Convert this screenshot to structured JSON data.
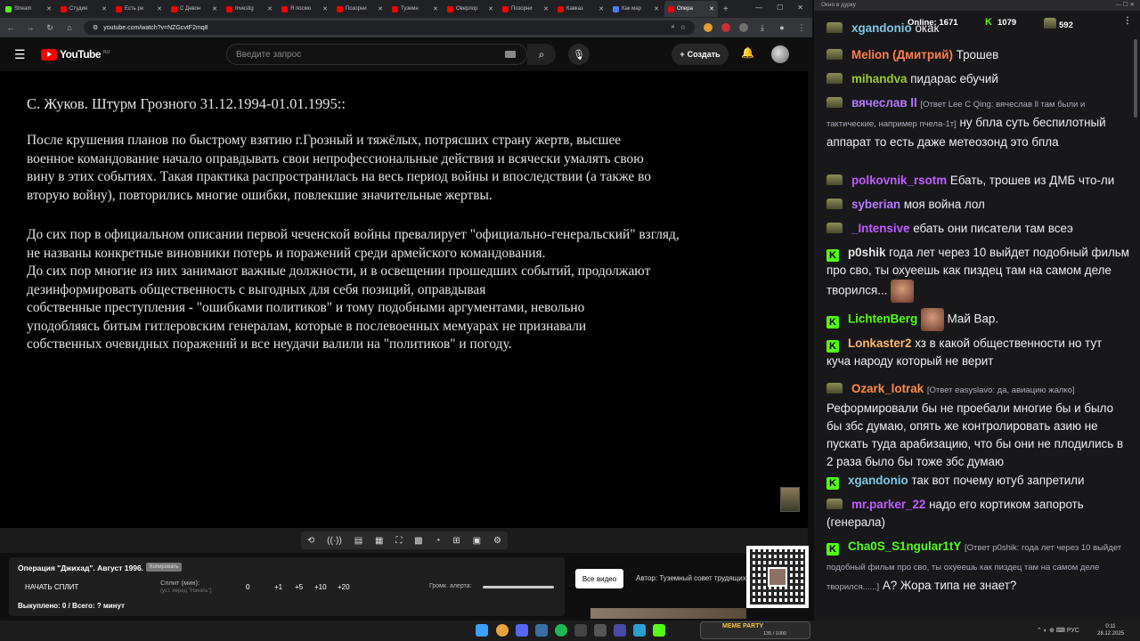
{
  "browser": {
    "tabs": [
      {
        "label": "Stream",
        "color": "#53fc18"
      },
      {
        "label": "Студия",
        "color": "#ff0000"
      },
      {
        "label": "Есть ре",
        "color": "#ff0000"
      },
      {
        "label": "С Девон",
        "color": "#ff0000"
      },
      {
        "label": "Investig",
        "color": "#ff0000"
      },
      {
        "label": "Я посмо",
        "color": "#ff0000"
      },
      {
        "label": "Позорни",
        "color": "#ff0000"
      },
      {
        "label": "Туземн",
        "color": "#ff0000"
      },
      {
        "label": "Оверлор",
        "color": "#ff0000"
      },
      {
        "label": "Позорни",
        "color": "#ff0000"
      },
      {
        "label": "Кавказ",
        "color": "#ff0000"
      },
      {
        "label": "Как мар",
        "color": "#4a7cff"
      },
      {
        "label": "Опера",
        "color": "#ff0000"
      }
    ],
    "url": "youtube.com/watch?v=NZGcvtF2mq8"
  },
  "youtube": {
    "logo_text": "YouTube",
    "logo_region": "RU",
    "search_placeholder": "Введите запрос",
    "create_label": "Создать"
  },
  "video": {
    "title_line": "С. Жуков. Штурм Грозного 31.12.1994-01.01.1995::",
    "para1": "После крушения планов по быстрому взятию г.Грозный и тяжёлых, потрясших страну жертв, высшее\nвоенное командование начало оправдывать свои непрофессиональные действия и всячески умалять свою\n вину в этих событиях. Такая практика распространилась на весь период войны и впоследствии (а также во\nвторую войну), повторились многие ошибки, повлекшие значительные жертвы.",
    "para2": "До сих пор в официальном описании первой чеченской войны превалирует \"официально-генеральский\" взгляд,\n не названы конкретные виновники потерь и поражений среди армейского командования.\nДо сих пор многие из них занимают важные должности, и в освещении прошедших событий, продолжают\nдезинформировать общественность с выгодных для себя позиций, оправдывая\nсобственные преступления - \"ошибками политиков\" и тому подобными аргументами, невольно\nуподобляясь битым гитлеровским генералам, которые в послевоенных мемуарах не признавали\nсобственных очевидных поражений и все неудачи валили на \"политиков\" и погоду."
  },
  "split": {
    "title": "Операция \"Джихад\". Август 1996.",
    "badge": "Копировать",
    "start_label": "НАЧАТЬ СПЛИТ",
    "split_label": "Сплит (мин):",
    "split_hint": "(уст. перед \"Начать\")",
    "values": [
      "0",
      "+1",
      "+5",
      "+10",
      "+20"
    ],
    "volume_label": "Громк. алерта:",
    "done_label": "Выкуплено: 0 / Всего: ? минут"
  },
  "overlay": {
    "all_video": "Все видео",
    "author": "Автор: Туземный совет трудящихся"
  },
  "chat": {
    "header": "Окно в дурку",
    "online_label": "Online:",
    "online_count": "1671",
    "kick_count": "1079",
    "other_count": "592",
    "messages": [
      {
        "nick": "xgandonio",
        "text": "окак",
        "color": "#7ec8e3",
        "icon": "hat"
      },
      {
        "nick": "Melion (Дмитрий)",
        "text": "Трошев",
        "color": "#ff7f50",
        "icon": "hat"
      },
      {
        "nick": "mihandva",
        "text": "пидарас ебучий",
        "color": "#9acd32",
        "icon": "hat"
      },
      {
        "nick": "вячеслав ll",
        "reply": "[Ответ Lee C Qing: вячеслав ll там были и тактические, например пчела-1т]",
        "text": "ну бпла суть беспилотный аппарат   то есть даже метеозонд это бпла",
        "color": "#b57bff",
        "icon": "hat"
      },
      {
        "nick": "polkovnik_rsotm",
        "text": "Ебать, трошев из ДМБ что-ли",
        "color": "#c05cff",
        "icon": "hat"
      },
      {
        "nick": "syberian",
        "text": "моя война лол",
        "color": "#b57bff",
        "icon": "hat"
      },
      {
        "nick": "_Intensive",
        "text": "ебать они писатели там всеэ",
        "color": "#c05cff",
        "icon": "hat"
      },
      {
        "nick": "p0shik",
        "text": "года лет через 10 выйдет подобный фильм про сво, ты охуеешь как пиздец там на самом деле творился...",
        "color": "#e6e6e6",
        "icon": "kick"
      },
      {
        "nick": "LichtenBerg",
        "text": "Май Вар.",
        "color": "#53fc18",
        "icon": "kick"
      },
      {
        "nick": "Lonkaster2",
        "text": "хз в какой общественности но тут куча народу который не верит",
        "color": "#ffb86b",
        "icon": "kick"
      },
      {
        "nick": "Ozark_lotrak",
        "reply": "[Ответ easyslavo: да, авиацию жалко]",
        "text": "Реформировали бы не проебали многие бы и было бы збс думаю, опять же контролировать азию не пускать туда арабизацию, что бы они не плодились в 2 раза было бы тоже збс думаю",
        "color": "#ff8c42",
        "icon": "hat"
      },
      {
        "nick": "xgandonio",
        "text": "так вот почему ютуб запретили",
        "color": "#7ec8e3",
        "icon": "kick"
      },
      {
        "nick": "mr.parker_22",
        "text": "надо его кортиком запороть (генерала)",
        "color": "#c05cff",
        "icon": "hat"
      },
      {
        "nick": "Cha0S_S1ngular1tY",
        "reply": "[Ответ p0shik: года лет через 10 выйдет подобный фильм про сво, ты охуеешь как пиздец там на самом деле творился......]",
        "text": "А? Жора типа не знает?",
        "color": "#53fc18",
        "icon": "kick"
      }
    ]
  },
  "taskbar": {
    "meme_title": "MEME PARTY",
    "meme_count": "135 / 1000",
    "lang": "РУС",
    "time": "0:11",
    "date": "28.12.2025"
  }
}
